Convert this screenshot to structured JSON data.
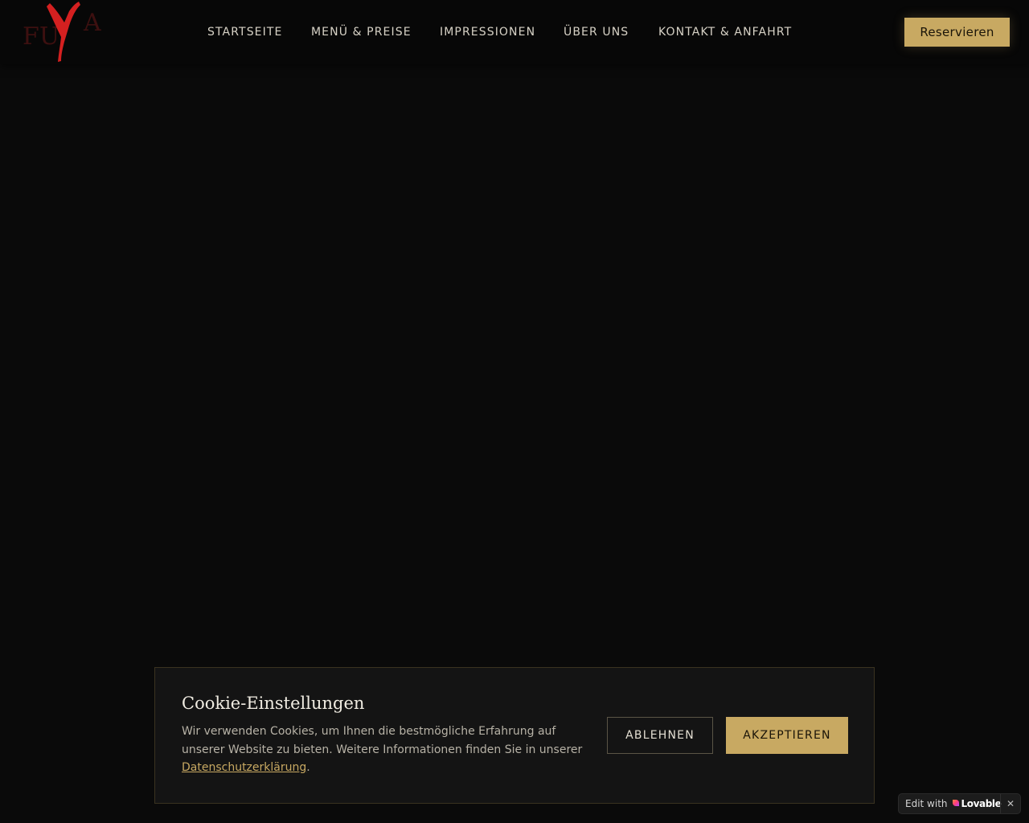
{
  "brand": {
    "logo_text_left": "FU",
    "logo_text_mark": "Y",
    "logo_text_right": "A",
    "logo_red": "#d42020",
    "logo_dark": "#4a1212"
  },
  "nav": {
    "items": [
      {
        "label": "STARTSEITE"
      },
      {
        "label": "MENÜ & PREISE"
      },
      {
        "label": "IMPRESSIONEN"
      },
      {
        "label": "ÜBER UNS"
      },
      {
        "label": "KONTAKT & ANFAHRT"
      }
    ],
    "reserve_label": "Reservieren"
  },
  "cookie": {
    "title": "Cookie-Einstellungen",
    "text_before_link": "Wir verwenden Cookies, um Ihnen die bestmögliche Erfahrung auf unserer Website zu bieten. Weitere Informationen finden Sie in unserer ",
    "link_label": "Datenschutzerklärung",
    "text_after_link": ".",
    "decline_label": "ABLEHNEN",
    "accept_label": "AKZEPTIEREN"
  },
  "badge": {
    "edit_label": "Edit with",
    "brand_label": "Lovable",
    "close_label": "✕",
    "heart_icon": "heart-icon"
  },
  "colors": {
    "accent_gold": "#c8a962",
    "background": "#0a0a0a",
    "panel": "#141414"
  }
}
